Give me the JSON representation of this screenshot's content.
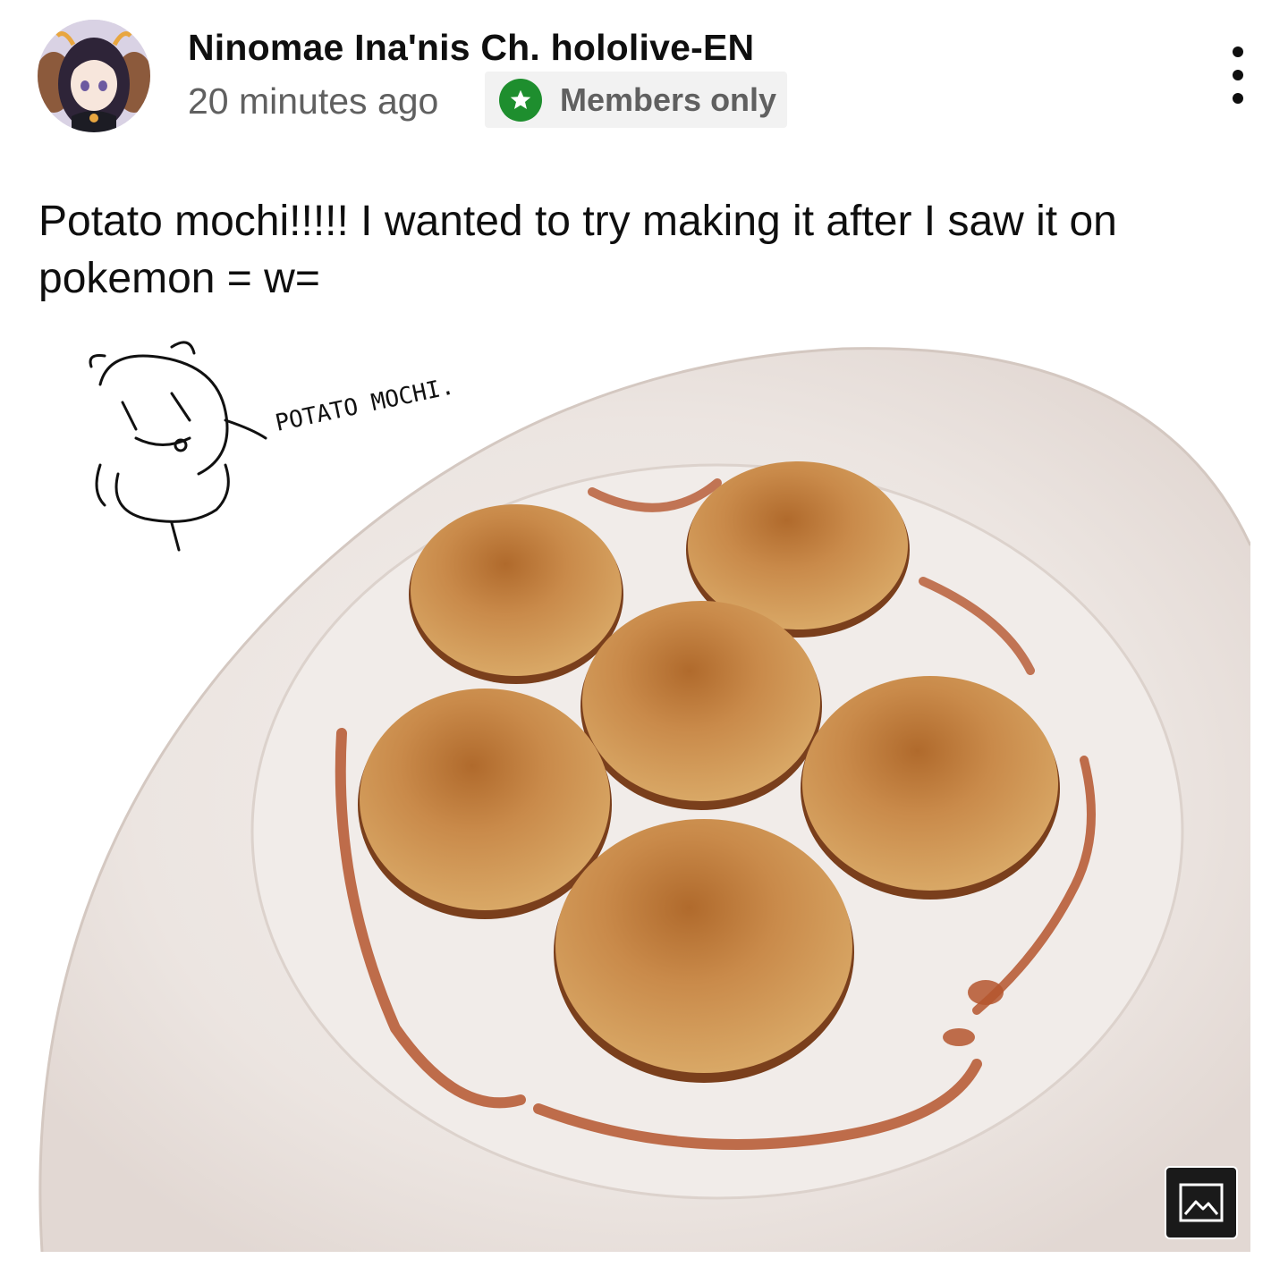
{
  "post": {
    "channel_name": "Ninomae Ina'nis Ch. hololive-EN",
    "timestamp": "20 minutes ago",
    "badge": {
      "label": "Members only",
      "icon": "star-icon",
      "icon_color": "#1e8e2e"
    },
    "more_icon": "three-dots-vertical-icon",
    "text": "Potato mochi!!!!! I wanted to try making it after I saw it on pokemon = w=",
    "image": {
      "sketch_caption": "POTATO MOCHI.",
      "view_button_icon": "image-icon"
    }
  }
}
